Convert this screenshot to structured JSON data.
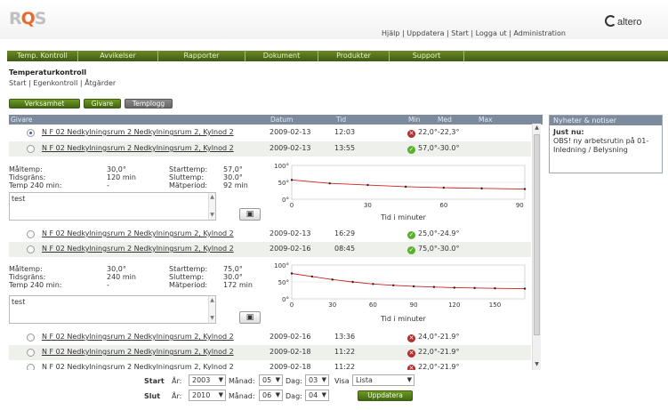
{
  "header": {
    "logo": "RQS",
    "links": [
      "Hjälp",
      "Uppdatera",
      "Start",
      "Logga ut",
      "Administration"
    ],
    "brand": "altero"
  },
  "nav": [
    "Temp. Kontroll",
    "Avvikelser",
    "Rapporter",
    "Dokument",
    "Produkter",
    "Support"
  ],
  "page": {
    "title": "Temperaturkontroll",
    "breadcrumb": "Start | Egenkontroll | Åtgärder"
  },
  "buttons": {
    "verksamhet": "Verksamhet",
    "givare": "Givare",
    "templogg": "Templogg"
  },
  "table": {
    "headers": [
      "Givare",
      "Datum",
      "Tid",
      "Min",
      "Med",
      "Max"
    ],
    "rows": [
      {
        "name": "N F 02 Nedkylningsrum 2 Nedkylningsrum 2, Kylnod 2",
        "date": "2009-02-13",
        "time": "12:03",
        "status": "error",
        "range": "22,0°-22,3°",
        "selected": true
      },
      {
        "name": "N F 02 Nedkylningsrum 2 Nedkylningsrum 2, Kylnod 2",
        "date": "2009-02-13",
        "time": "13:55",
        "status": "ok",
        "range": "57,0°-30.0°",
        "selected": false
      },
      {
        "name": "N F 02 Nedkylningsrum 2 Nedkylningsrum 2, Kylnod 2",
        "date": "2009-02-13",
        "time": "16:29",
        "status": "ok",
        "range": "25,0°-24.9°",
        "selected": false
      },
      {
        "name": "N F 02 Nedkylningsrum 2 Nedkylningsrum 2, Kylnod 2",
        "date": "2009-02-16",
        "time": "08:45",
        "status": "ok",
        "range": "75,0°-30.0°",
        "selected": false
      },
      {
        "name": "N F 02 Nedkylningsrum 2 Nedkylningsrum 2, Kylnod 2",
        "date": "2009-02-16",
        "time": "13:36",
        "status": "error",
        "range": "24,0°-21.9°",
        "selected": false
      },
      {
        "name": "N F 02 Nedkylningsrum 2 Nedkylningsrum 2, Kylnod 2",
        "date": "2009-02-18",
        "time": "11:22",
        "status": "error",
        "range": "22,0°-21.9°",
        "selected": false
      },
      {
        "name": "N F 02 Nedkylningsrum 2 Nedkylningsrum 2, Kylnod 2",
        "date": "2009-02-18",
        "time": "11:22",
        "status": "error",
        "range": "22,0°-21.9°",
        "selected": false
      }
    ]
  },
  "details": [
    {
      "labels": {
        "maltemp": "Måltemp:",
        "tidsgrans": "Tidsgräns:",
        "temp240": "Temp 240 min:",
        "starttemp": "Starttemp:",
        "sluttemp": "Sluttemp:",
        "matperiod": "Mätperiod:"
      },
      "values": {
        "maltemp": "30,0°",
        "tidsgrans": "120 min",
        "temp240": "-",
        "starttemp": "57,0°",
        "sluttemp": "30.0°",
        "matperiod": "92 min"
      },
      "note": "test",
      "chart": {
        "yticks": [
          "100°",
          "50°",
          "0°"
        ],
        "xlabel": "Tid i minuter",
        "xticks": [
          "0",
          "30",
          "60",
          "90"
        ],
        "xmax": 92,
        "points": [
          [
            0,
            57
          ],
          [
            15,
            47
          ],
          [
            30,
            42
          ],
          [
            45,
            37
          ],
          [
            60,
            34
          ],
          [
            75,
            32
          ],
          [
            92,
            30
          ]
        ]
      }
    },
    {
      "labels": {
        "maltemp": "Måltemp:",
        "tidsgrans": "Tidsgräns:",
        "temp240": "Temp 240 min:",
        "starttemp": "Starttemp:",
        "sluttemp": "Sluttemp:",
        "matperiod": "Mätperiod:"
      },
      "values": {
        "maltemp": "30,0°",
        "tidsgrans": "240 min",
        "temp240": "-",
        "starttemp": "75,0°",
        "sluttemp": "30.0°",
        "matperiod": "172 min"
      },
      "note": "test",
      "chart": {
        "yticks": [
          "100°",
          "50°",
          "0°"
        ],
        "xlabel": "Tid i minuter",
        "xticks": [
          "0",
          "30",
          "60",
          "90",
          "120",
          "150"
        ],
        "xmax": 172,
        "points": [
          [
            0,
            75
          ],
          [
            15,
            66
          ],
          [
            30,
            57
          ],
          [
            45,
            50
          ],
          [
            60,
            44
          ],
          [
            75,
            40
          ],
          [
            90,
            37
          ],
          [
            105,
            35
          ],
          [
            120,
            33
          ],
          [
            135,
            32
          ],
          [
            150,
            31
          ],
          [
            172,
            30
          ]
        ]
      }
    }
  ],
  "news": {
    "title": "Nyheter & notiser",
    "heading": "Just nu:",
    "text": "OBS! ny arbetsrutin på 01-Inledning / Belysning"
  },
  "filter": {
    "start_label": "Start",
    "slut_label": "Slut",
    "ar_label": "År:",
    "manad_label": "Månad:",
    "dag_label": "Dag:",
    "start": {
      "year": "2003",
      "month": "05",
      "day": "03"
    },
    "slut": {
      "year": "2010",
      "month": "06",
      "day": "04"
    },
    "visa_label": "Visa",
    "visa_value": "Lista",
    "update_button": "Uppdatera"
  },
  "colors": {
    "nav_green": "#4a6a18",
    "header_gray": "#7b8a9c",
    "error": "#b03030",
    "ok": "#58b02e"
  }
}
